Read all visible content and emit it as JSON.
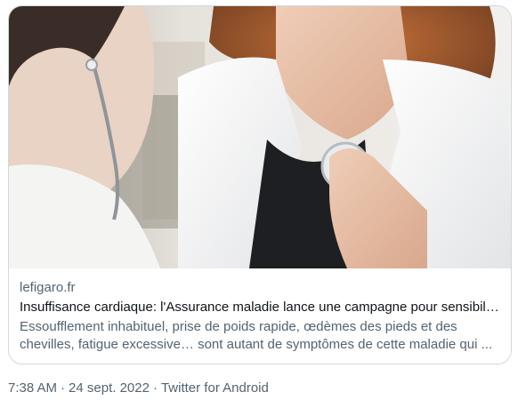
{
  "card": {
    "image_alt": "Médecin auscultant une patiente avec un stéthoscope",
    "domain": "lefigaro.fr",
    "title": "Insuffisance cardiaque: l'Assurance maladie lance une campagne pour sensibiliser",
    "description": "Essoufflement inhabituel, prise de poids rapide, œdèmes des pieds et des chevilles, fatigue excessive… sont autant de symptômes de cette maladie qui ..."
  },
  "footer": {
    "time": "7:38 AM",
    "date": "24 sept. 2022",
    "source": "Twitter for Android",
    "separator": "·"
  }
}
